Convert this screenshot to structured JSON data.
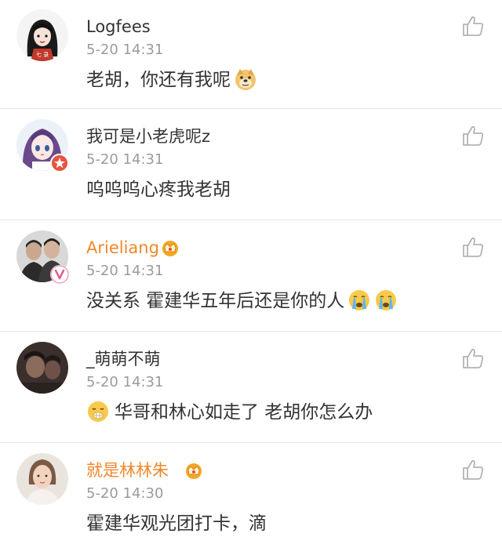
{
  "comments": [
    {
      "username": "Logfees",
      "time": "5-20 14:31",
      "text": "老胡，你还有我呢",
      "avatar_icon": "girl-avatar-icon",
      "trailing_emoji": [
        "doge-emoji-icon"
      ]
    },
    {
      "username": "我可是小老虎呢z",
      "time": "5-20 14:31",
      "text": "呜呜呜心疼我老胡",
      "avatar_icon": "anime-girl-avatar-icon",
      "badge_icon": "star-badge-icon"
    },
    {
      "username": "Arieliang",
      "time": "5-20 14:31",
      "text": "没关系 霍建华五年后还是你的人",
      "avatar_icon": "two-men-photo-avatar-icon",
      "badge_icon": "vip-v-badge-icon",
      "username_badge": "vip-crown-icon",
      "trailing_emoji": [
        "crying-emoji-icon",
        "crying-emoji-icon"
      ]
    },
    {
      "username": "_萌萌不萌",
      "time": "5-20 14:31",
      "text": "华哥和林心如走了 老胡你怎么办",
      "avatar_icon": "dim-photo-avatar-icon",
      "leading_emoji": "hush-emoji-icon"
    },
    {
      "username": "就是林林朱",
      "time": "5-20 14:30",
      "text": "霍建华观光团打卡，滴",
      "avatar_icon": "woman-portrait-avatar-icon",
      "username_badge": "vip-crown-icon"
    }
  ],
  "colors": {
    "username": "#333333",
    "vip_username": "#f0882d",
    "timestamp": "#9b9b9b",
    "divider": "#e6e6e6",
    "like_icon": "#b3b3b3"
  }
}
